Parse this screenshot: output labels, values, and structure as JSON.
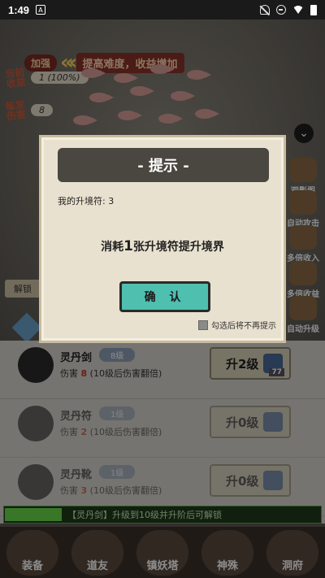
{
  "status_bar": {
    "time": "1:49",
    "a_label": "A"
  },
  "game": {
    "buff": {
      "tag": "加强",
      "text": "提高难度，收益增加"
    },
    "stats": [
      {
        "label": "当前收益",
        "value": "1 (100%)"
      },
      {
        "label": "每发伤害",
        "value": "8"
      }
    ],
    "side_buttons": [
      "观影阁",
      "自动攻击",
      "多倍收入",
      "多倍收益",
      "自动升级"
    ],
    "unlock_label": "解锁"
  },
  "equipment": [
    {
      "name": "灵丹剑",
      "level": "8级",
      "damage_label": "伤害",
      "damage": "8",
      "note": "(10级后伤害翻倍)",
      "upgrade": "升2级",
      "count": "77",
      "locked": false
    },
    {
      "name": "灵丹符",
      "level": "1级",
      "damage_label": "伤害",
      "damage": "2",
      "note": "(10级后伤害翻倍)",
      "upgrade": "升0级",
      "count": "",
      "locked": true
    },
    {
      "name": "灵丹靴",
      "level": "1级",
      "damage_label": "伤害",
      "damage": "3",
      "note": "(10级后伤害翻倍)",
      "upgrade": "升0级",
      "count": "",
      "locked": true
    }
  ],
  "notice": "【灵丹剑】升级到10级并升阶后可解锁",
  "nav": [
    "装备",
    "道友",
    "镇妖塔",
    "神殊",
    "洞府"
  ],
  "dialog": {
    "title": "- 提示 -",
    "line": "我的升境符: 3",
    "main_prefix": "消耗",
    "main_num": "1",
    "main_suffix": "张升境符提升境界",
    "confirm": "确 认",
    "checkbox_label": "勾选后将不再提示"
  }
}
